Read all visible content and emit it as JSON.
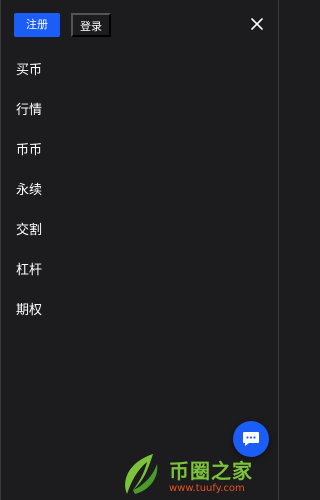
{
  "header": {
    "register_label": "注册",
    "login_label": "登录",
    "close_icon": "close-icon"
  },
  "menu": {
    "items": [
      {
        "label": "买币"
      },
      {
        "label": "行情"
      },
      {
        "label": "币币"
      },
      {
        "label": "永续"
      },
      {
        "label": "交割"
      },
      {
        "label": "杠杆"
      },
      {
        "label": "期权"
      }
    ]
  },
  "chat": {
    "icon": "chat-icon"
  },
  "watermark": {
    "logo_icon": "leaf-logo-icon",
    "brand": "币圈之家",
    "url": "www.tuufy.com"
  },
  "colors": {
    "background": "#1c1c1e",
    "accent": "#1a5df7",
    "watermark_green": "#7cc23a",
    "watermark_orange": "#e8531d"
  }
}
